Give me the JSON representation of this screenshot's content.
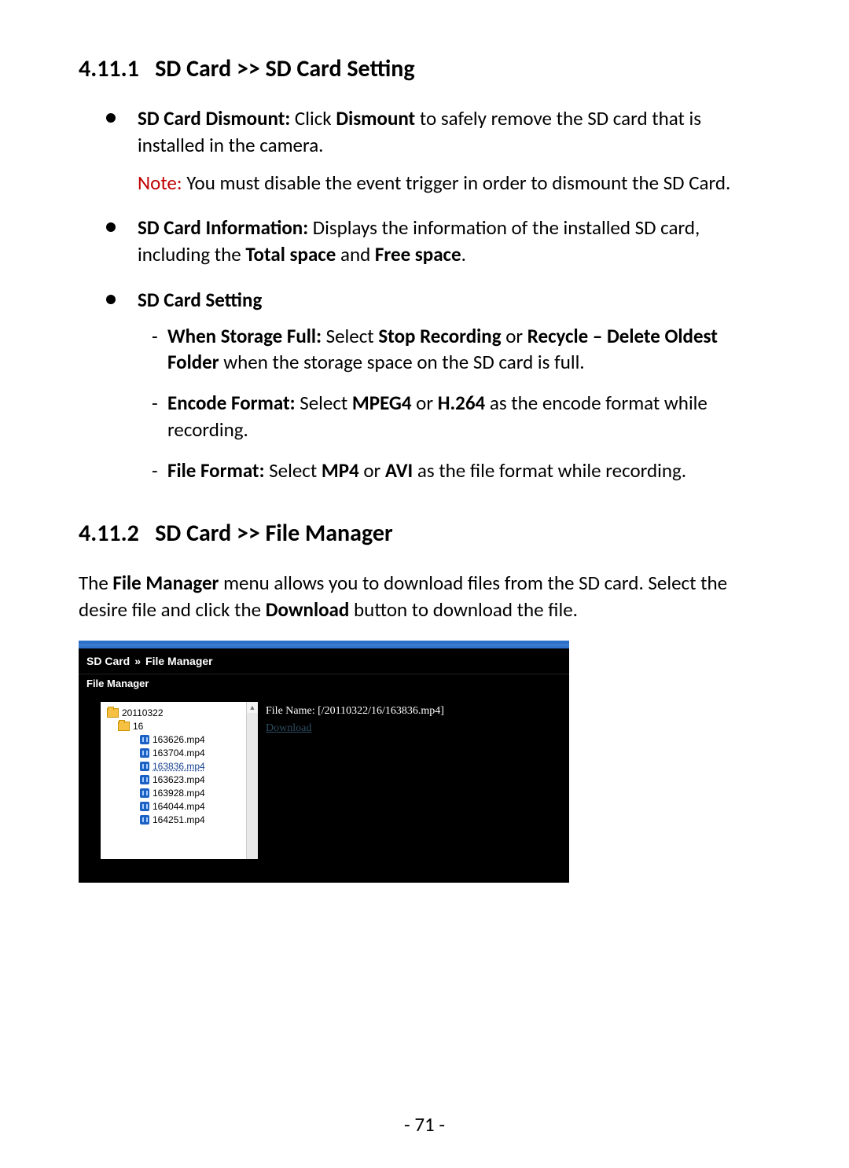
{
  "section1": {
    "number": "4.11.1",
    "title": "SD Card >> SD Card Setting",
    "bullet_dismount_label": "SD Card Dismount:",
    "bullet_dismount_text1": " Click ",
    "bullet_dismount_bold1": "Dismount",
    "bullet_dismount_text2": " to safely remove the SD card that is installed in the camera.",
    "note_label": "Note:",
    "note_text": "  You must disable the event trigger in order to dismount the SD Card.",
    "bullet_info_label": "SD Card Information:",
    "bullet_info_text1": " Displays the information of the installed SD card, including the ",
    "bullet_info_bold1": "Total space",
    "bullet_info_text2": " and ",
    "bullet_info_bold2": "Free space",
    "bullet_info_text3": ".",
    "bullet_setting_label": "SD Card Setting",
    "dash_storage_label": "When Storage Full:",
    "dash_storage_text1": " Select ",
    "dash_storage_bold1": "Stop Recording",
    "dash_storage_text2": " or ",
    "dash_storage_bold2": "Recycle – Delete Oldest Folder",
    "dash_storage_text3": " when the storage space on the SD card is full.",
    "dash_encode_label": "Encode Format:",
    "dash_encode_text1": " Select ",
    "dash_encode_bold1": "MPEG4",
    "dash_encode_text2": " or ",
    "dash_encode_bold2": "H.264",
    "dash_encode_text3": " as the encode format while recording.",
    "dash_file_label": "File Format:",
    "dash_file_text1": " Select ",
    "dash_file_bold1": "MP4",
    "dash_file_text2": " or ",
    "dash_file_bold2": "AVI",
    "dash_file_text3": " as the file format while recording."
  },
  "section2": {
    "number": "4.11.2",
    "title": "SD Card >> File Manager",
    "para_text1": "The ",
    "para_bold1": "File Manager",
    "para_text2": " menu allows you to download files from the SD card. Select the desire file and click the ",
    "para_bold2": "Download",
    "para_text3": " button to download the file."
  },
  "file_manager": {
    "breadcrumb_a": "SD Card",
    "breadcrumb_sep": "»",
    "breadcrumb_b": "File Manager",
    "section_label": "File Manager",
    "tree": {
      "folders": [
        "20110322",
        "16"
      ],
      "files": [
        "163626.mp4",
        "163704.mp4",
        "163836.mp4",
        "163623.mp4",
        "163928.mp4",
        "164044.mp4",
        "164251.mp4"
      ],
      "selected_index": 2
    },
    "file_name_label": "File Name:",
    "file_name_value": "[/20110322/16/163836.mp4]",
    "download_label": "Download"
  },
  "page_number": "- 71 -"
}
